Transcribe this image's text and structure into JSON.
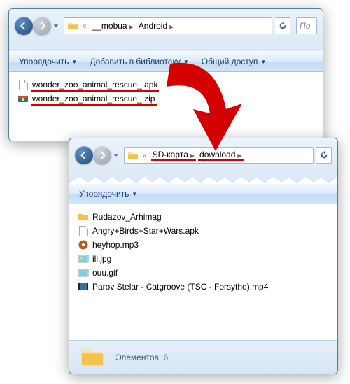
{
  "w1": {
    "path": {
      "prefix": "«",
      "seg1": "__mobua",
      "seg2": "Android"
    },
    "toolbar": {
      "organize": "Упорядочить",
      "addlib": "Добавить в библиотеку",
      "share": "Общий доступ"
    },
    "search_placeholder": "По",
    "files": [
      {
        "name": "wonder_zoo_animal_rescue_.apk",
        "icon": "blank",
        "redwidth": 182
      },
      {
        "name": "wonder_zoo_animal_rescue_.zip",
        "icon": "zip",
        "redwidth": 180
      }
    ]
  },
  "w2": {
    "path": {
      "prefix": "«",
      "seg1": "SD-карта",
      "seg2": "download"
    },
    "toolbar": {
      "organize": "Упорядочить"
    },
    "files": [
      {
        "name": "Rudazov_Arhimag",
        "icon": "folder"
      },
      {
        "name": "Angry+Birds+Star+Wars.apk",
        "icon": "blank"
      },
      {
        "name": "heyhop.mp3",
        "icon": "mp3"
      },
      {
        "name": "ill.jpg",
        "icon": "img"
      },
      {
        "name": "ouu.gif",
        "icon": "img"
      },
      {
        "name": "Parov Stelar - Catgroove (TSC - Forsythe).mp4",
        "icon": "video"
      }
    ],
    "status": "Элементов: 6"
  }
}
